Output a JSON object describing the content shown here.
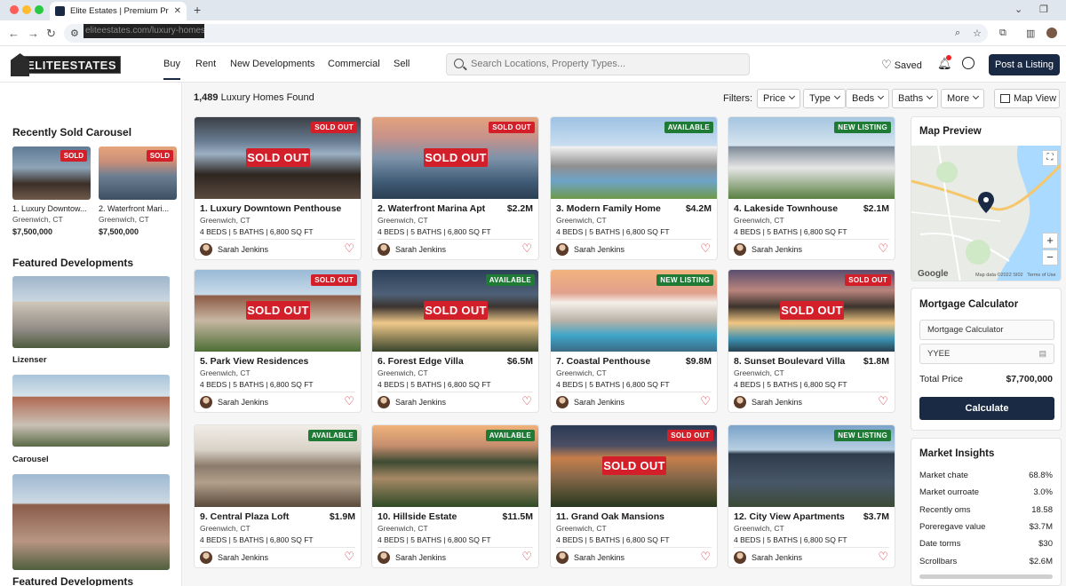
{
  "browser": {
    "tab_title": "Elite Estates | Premium Proper",
    "url": "eliteestates.com/luxury-homes"
  },
  "header": {
    "logo": "ELITEESTATES",
    "nav": [
      "Buy",
      "Rent",
      "New Developments",
      "Commercial",
      "Sell"
    ],
    "search_placeholder": "Search Locations, Property Types...",
    "saved_label": "Saved",
    "post_button": "Post a Listing"
  },
  "sidebar": {
    "recently_sold_title": "Recently Sold Carousel",
    "recently_sold": [
      {
        "title": "1. Luxury Downtow...",
        "location": "Greenwich, CT",
        "price": "$7,500,000",
        "badge": "SOLD"
      },
      {
        "title": "2. Waterfront Mari...",
        "location": "Greenwich, CT",
        "price": "$7,500,000",
        "badge": "SOLD"
      }
    ],
    "featured_title": "Featured Developments",
    "featured": [
      {
        "label": "Lizenser"
      },
      {
        "label": "Carousel"
      },
      {
        "label": ""
      }
    ],
    "featured_title_2": "Featured Developments"
  },
  "results": {
    "count": "1,489",
    "suffix": "Luxury Homes Found",
    "filters_label": "Filters:",
    "filters": [
      "Price",
      "Type",
      "Beds",
      "Baths",
      "More"
    ],
    "map_view": "Map View"
  },
  "listings": [
    {
      "title": "1. Luxury Downtown Penthouse",
      "price": "",
      "location": "Greenwich, CT",
      "beds": "4 BEDS",
      "baths": "5 BATHS",
      "sqft": "6,800 SQ FT",
      "agent": "Sarah Jenkins",
      "badge": "SOLD OUT",
      "badge_color": "#d31f2a",
      "overlay": "SOLD OUT"
    },
    {
      "title": "2. Waterfront Marina Apt",
      "price": "$2.2M",
      "location": "Greenwich, CT",
      "beds": "4 BEDS",
      "baths": "5 BATHS",
      "sqft": "6,800 SQ FT",
      "agent": "Sarah Jenkins",
      "badge": "SOLD OUT",
      "badge_color": "#d31f2a",
      "overlay": "SOLD OUT"
    },
    {
      "title": "3. Modern Family Home",
      "price": "$4.2M",
      "location": "Greenwich, CT",
      "beds": "4 BEDS",
      "baths": "5 BATHS",
      "sqft": "6,800 SQ FT",
      "agent": "Sarah Jenkins",
      "badge": "AVAILABLE",
      "badge_color": "#1f7a36",
      "overlay": ""
    },
    {
      "title": "4. Lakeside Townhouse",
      "price": "$2.1M",
      "location": "Greenwich, CT",
      "beds": "4 BEDS",
      "baths": "5 BATHS",
      "sqft": "6,800 SQ FT",
      "agent": "Sarah Jenkins",
      "badge": "NEW LISTING",
      "badge_color": "#1f7a36",
      "overlay": ""
    },
    {
      "title": "5. Park View Residences",
      "price": "",
      "location": "Greenwich, CT",
      "beds": "4 BEDS",
      "baths": "5 BATHS",
      "sqft": "6,800 SQ FT",
      "agent": "Sarah Jenkins",
      "badge": "SOLD OUT",
      "badge_color": "#d31f2a",
      "overlay": "SOLD OUT"
    },
    {
      "title": "6. Forest Edge Villa",
      "price": "$6.5M",
      "location": "Greenwich, CT",
      "beds": "4 BEDS",
      "baths": "5 BATHS",
      "sqft": "6,800 SQ FT",
      "agent": "Sarah Jenkins",
      "badge": "AVAILABLE",
      "badge_color": "#1f7a36",
      "overlay": "SOLD OUT"
    },
    {
      "title": "7. Coastal Penthouse",
      "price": "$9.8M",
      "location": "Greenwich, CT",
      "beds": "4 BEDS",
      "baths": "5 BATHS",
      "sqft": "6,800 SQ FT",
      "agent": "Sarah Jenkins",
      "badge": "NEW LISTING",
      "badge_color": "#1f7a36",
      "overlay": ""
    },
    {
      "title": "8. Sunset Boulevard Villa",
      "price": "$1.8M",
      "location": "Greenwich, CT",
      "beds": "4 BEDS",
      "baths": "5 BATHS",
      "sqft": "6,800 SQ FT",
      "agent": "Sarah Jenkins",
      "badge": "SOLD OUT",
      "badge_color": "#d31f2a",
      "overlay": "SOLD OUT"
    },
    {
      "title": "9. Central Plaza Loft",
      "price": "$1.9M",
      "location": "Greenwich, CT",
      "beds": "4 BEDS",
      "baths": "5 BATHS",
      "sqft": "6,800 SQ FT",
      "agent": "Sarah Jenkins",
      "badge": "AVAILABLE",
      "badge_color": "#1f7a36",
      "overlay": ""
    },
    {
      "title": "10. Hillside Estate",
      "price": "$11.5M",
      "location": "Greenwich, CT",
      "beds": "4 BEDS",
      "baths": "5 BATHS",
      "sqft": "6,800 SQ FT",
      "agent": "Sarah Jenkins",
      "badge": "AVAILABLE",
      "badge_color": "#1f7a36",
      "overlay": ""
    },
    {
      "title": "11. Grand Oak Mansions",
      "price": "",
      "location": "Greenwich, CT",
      "beds": "4 BEDS",
      "baths": "5 BATHS",
      "sqft": "6,800 SQ FT",
      "agent": "Sarah Jenkins",
      "badge": "SOLD OUT",
      "badge_color": "#d31f2a",
      "overlay": "SOLD OUT"
    },
    {
      "title": "12. City View Apartments",
      "price": "$3.7M",
      "location": "Greenwich, CT",
      "beds": "4 BEDS",
      "baths": "5 BATHS",
      "sqft": "6,800 SQ FT",
      "agent": "Sarah Jenkins",
      "badge": "NEW LISTING",
      "badge_color": "#1f7a36",
      "overlay": ""
    }
  ],
  "right": {
    "map_title": "Map Preview",
    "map_attribution": "Map data ©2022 SI02",
    "map_terms": "Terms of Use",
    "map_brand": "Google",
    "mortgage_title": "Mortgage Calculator",
    "mortgage_field1": "Mortgage Calculator",
    "mortgage_field2": "YYEE",
    "total_price_label": "Total Price",
    "total_price_value": "$7,700,000",
    "calculate": "Calculate",
    "insights_title": "Market Insights",
    "insights": [
      {
        "label": "Market chate",
        "value": "68.8%"
      },
      {
        "label": "Market ourroate",
        "value": "3.0%"
      },
      {
        "label": "Recently oms",
        "value": "18.58"
      },
      {
        "label": "Poreregave value",
        "value": "$3.7M"
      },
      {
        "label": "Date torms",
        "value": "$30"
      },
      {
        "label": "Scrollbars",
        "value": "$2.6M"
      }
    ]
  },
  "colors": {
    "brand": "#1b2a44",
    "sold": "#d31f2a",
    "available": "#1f7a36"
  }
}
